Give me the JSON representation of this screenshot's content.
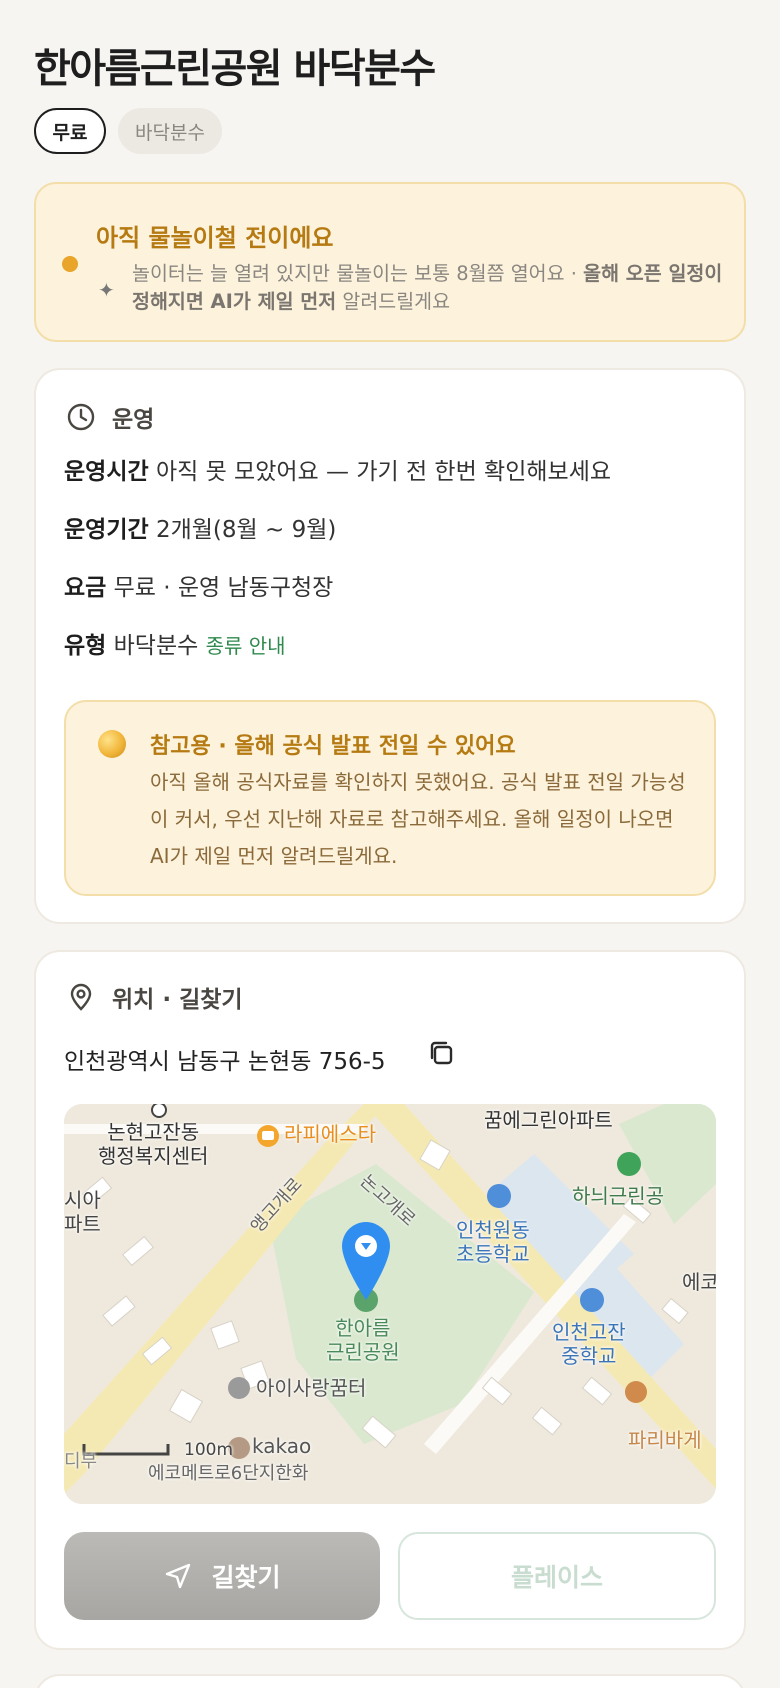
{
  "page": {
    "title": "한아름근린공원 바닥분수",
    "chips": {
      "price": "무료",
      "type": "바닥분수"
    }
  },
  "notice": {
    "title": "아직 물놀이철 전이에요",
    "text_plain": "놀이터는 늘 열려 있지만 물놀이는 보통 8월쯤 열어요 · ",
    "text_bold": "올해 오픈 일정이 정해지면 AI가 제일 먼저",
    "text_tail": " 알려드릴게요"
  },
  "operation": {
    "section_label": "운영",
    "rows": [
      {
        "key": "운영시간",
        "value": "아직 못 모았어요 — 가기 전 한번 확인해보세요"
      },
      {
        "key": "운영기간",
        "value": "2개월(8월 ~ 9월)"
      },
      {
        "key": "요금",
        "value": "무료 · 운영 남동구청장"
      },
      {
        "key": "유형",
        "value": "바닥분수",
        "link": "종류 안내"
      }
    ],
    "reference": {
      "title": "참고용 · 올해 공식 발표 전일 수 있어요",
      "body": "아직 올해 공식자료를 확인하지 못했어요. 공식 발표 전일 가능성이 커서, 우선 지난해 자료로 참고해주세요. 올해 일정이 나오면 AI가 제일 먼저 알려드릴게요."
    }
  },
  "location": {
    "section_label": "위치 · 길찾기",
    "address": "인천광역시 남동구 논현동 756-5",
    "map": {
      "labels": {
        "office": "논현고잔동\n행정복지센터",
        "cafe": "라피에스타",
        "apt_top": "꿈에그린아파트",
        "park_right": "하늬근린공",
        "road1": "앵고개로",
        "road2": "논고개로",
        "school1": "인천원동\n초등학교",
        "edge_right": "에코",
        "school2": "인천고잔\n중학교",
        "park_main": "한아름\n근린공원",
        "daycare": "아이사랑꿈터",
        "bakery": "파리바게",
        "edge_left_top": "시아\n파트",
        "scale": "100m",
        "brand": "kakao",
        "bottom_partial": "에코메트로6단지한화",
        "left_partial": "디부"
      }
    },
    "buttons": {
      "navigate": "길찾기",
      "place": "플레이스"
    }
  },
  "colors": {
    "accent_gold": "#b57b12",
    "notice_bg": "#fdf2dc",
    "link_green": "#2f8a4e",
    "pin_blue": "#2f8ef0"
  }
}
